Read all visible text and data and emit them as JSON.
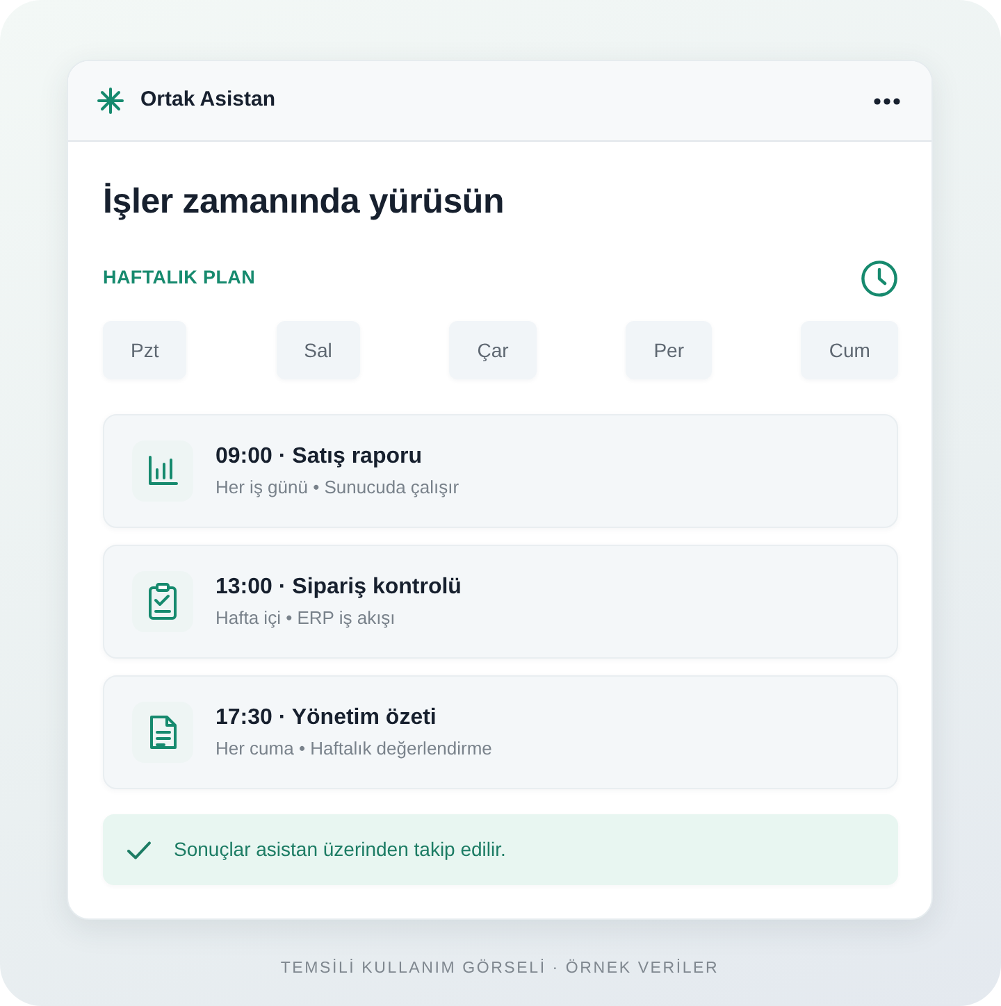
{
  "app": {
    "name": "Ortak Asistan"
  },
  "heading": "İşler zamanında yürüsün",
  "section": {
    "label": "HAFTALIK PLAN"
  },
  "days": [
    "Pzt",
    "Sal",
    "Çar",
    "Per",
    "Cum"
  ],
  "tasks": [
    {
      "kind": "chart",
      "title": "09:00 · Satış raporu",
      "detail": "Her iş günü • Sunucuda çalışır"
    },
    {
      "kind": "checklist",
      "title": "13:00 · Sipariş kontrolü",
      "detail": "Hafta içi • ERP iş akışı"
    },
    {
      "kind": "document",
      "title": "17:30 · Yönetim özeti",
      "detail": "Her cuma • Haftalık değerlendirme"
    }
  ],
  "notice": {
    "text": "Sonuçlar asistan üzerinden takip edilir."
  },
  "caption": "TEMSİLİ KULLANIM GÖRSELİ · ÖRNEK VERİLER"
}
